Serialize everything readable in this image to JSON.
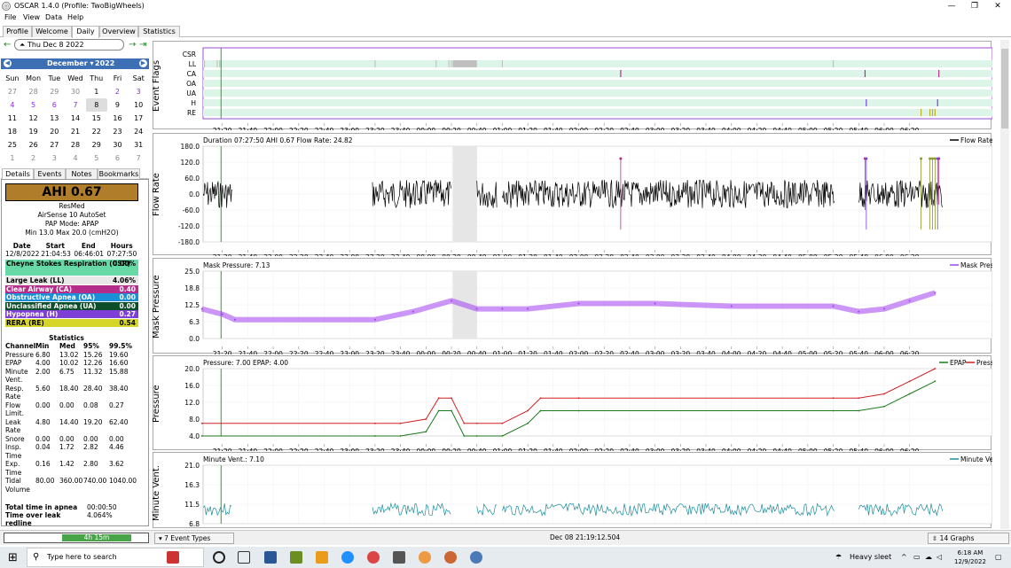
{
  "window": {
    "title": "OSCAR 1.4.0 (Profile: TwoBigWheels)",
    "icon": "oscar-icon"
  },
  "menu": [
    "File",
    "View",
    "Data",
    "Help"
  ],
  "tabs": [
    "Profile",
    "Welcome",
    "Daily",
    "Overview",
    "Statistics"
  ],
  "active_tab": "Daily",
  "date": {
    "current": "Thu Dec 8 2022"
  },
  "calendar": {
    "month": "December",
    "year": "2022",
    "dow": [
      "Sun",
      "Mon",
      "Tue",
      "Wed",
      "Thu",
      "Fri",
      "Sat"
    ],
    "weeks": [
      [
        "27",
        "28",
        "29",
        "30",
        "1",
        "2",
        "3"
      ],
      [
        "4",
        "5",
        "6",
        "7",
        "8",
        "9",
        "10"
      ],
      [
        "11",
        "12",
        "13",
        "14",
        "15",
        "16",
        "17"
      ],
      [
        "18",
        "19",
        "20",
        "21",
        "22",
        "23",
        "24"
      ],
      [
        "25",
        "26",
        "27",
        "28",
        "29",
        "30",
        "31"
      ],
      [
        "1",
        "2",
        "3",
        "4",
        "5",
        "6",
        "7"
      ]
    ]
  },
  "side_tabs": [
    "Details",
    "Events",
    "Notes",
    "Bookmarks"
  ],
  "details": {
    "ahi": "AHI 0.67",
    "brand": "ResMed",
    "model": "AirSense 10 AutoSet",
    "mode": "PAP Mode: APAP",
    "pressure": "Min 13.0 Max 20.0 (cmH2O)",
    "session_headers": [
      "Date",
      "Start",
      "End",
      "Hours"
    ],
    "session": [
      "12/8/2022",
      "21:04:53",
      "06:46:01",
      "07:27:50"
    ],
    "indices": [
      {
        "label": "Cheyne Stokes Respiration (CSR)",
        "value": "0.00%",
        "color": "#66d9a6"
      },
      {
        "label": "Large Leak (LL)",
        "value": "4.06%",
        "color": "#e8e8e8"
      },
      {
        "label": "Clear Airway (CA)",
        "value": "0.40",
        "color": "#b52d8a"
      },
      {
        "label": "Obstructive Apnea (OA)",
        "value": "0.00",
        "color": "#1a8ed6"
      },
      {
        "label": "Unclassified Apnea (UA)",
        "value": "0.00",
        "color": "#0e4d2a"
      },
      {
        "label": "Hypopnea (H)",
        "value": "0.27",
        "color": "#7e3fd6"
      },
      {
        "label": "RERA (RE)",
        "value": "0.54",
        "color": "#d6d62a"
      }
    ],
    "stats_title": "Statistics",
    "stats_headers": [
      "Channel",
      "Min",
      "Med",
      "95%",
      "99.5%"
    ],
    "stats_rows": [
      [
        "Pressure",
        "6.80",
        "13.02",
        "15.26",
        "19.60"
      ],
      [
        "EPAP",
        "4.00",
        "10.02",
        "12.26",
        "16.60"
      ],
      [
        "Minute Vent.",
        "2.00",
        "6.75",
        "11.32",
        "15.88"
      ],
      [
        "Resp. Rate",
        "5.60",
        "18.40",
        "28.40",
        "38.40"
      ],
      [
        "Flow Limit.",
        "0.00",
        "0.00",
        "0.08",
        "0.27"
      ],
      [
        "Leak Rate",
        "4.80",
        "14.40",
        "19.20",
        "62.40"
      ],
      [
        "Snore",
        "0.00",
        "0.00",
        "0.00",
        "0.00"
      ],
      [
        "Insp. Time",
        "0.04",
        "1.72",
        "2.82",
        "4.46"
      ],
      [
        "Exp. Time",
        "0.16",
        "1.42",
        "2.80",
        "3.62"
      ],
      [
        "Tidal Volume",
        "80.00",
        "360.00",
        "740.00",
        "1040.00"
      ]
    ],
    "totals": [
      [
        "Total time in apnea",
        "00:00:50"
      ],
      [
        "Time over leak redline",
        "4.064%"
      ]
    ]
  },
  "bottom": {
    "duration_bar": "4h 15m",
    "event_types": "7 Event Types",
    "cursor_time": "Dec 08 21:19:12.504",
    "graphs": "14 Graphs"
  },
  "time_ticks": [
    "21:20",
    "21:40",
    "22:00",
    "22:20",
    "22:40",
    "23:00",
    "23:20",
    "23:40",
    "00:00",
    "00:20",
    "00:40",
    "01:00",
    "01:20",
    "01:40",
    "02:00",
    "02:20",
    "02:40",
    "03:00",
    "03:20",
    "03:40",
    "04:00",
    "04:20",
    "04:40",
    "05:00",
    "05:20",
    "05:40",
    "06:00",
    "06:20"
  ],
  "time_range": [
    "21:04:53",
    "06:46:01"
  ],
  "event_flags": {
    "title": "Event Flags",
    "rows": [
      "CSR",
      "LL",
      "CA",
      "OA",
      "UA",
      "H",
      "RE"
    ]
  },
  "charts": [
    {
      "id": "flow",
      "ylabel": "Flow Rate",
      "header": "Duration 07:27:50 AHI 0.67 Flow Rate: 24.82",
      "legend": "Flow Rate",
      "color": "#000000",
      "yticks": [
        "180.0",
        "120.0",
        "60.0",
        "0.0",
        "-60.0",
        "-120.0",
        "-180.0"
      ]
    },
    {
      "id": "mask",
      "ylabel": "Mask Pressure",
      "header": "Mask Pressure: 7.13",
      "legend": "Mask Pressure",
      "color": "#a040f0",
      "yticks": [
        "25.0",
        "18.8",
        "12.5",
        "6.3",
        "0.0"
      ]
    },
    {
      "id": "pressure",
      "ylabel": "Pressure",
      "header": "Pressure: 7.00 EPAP: 4.00",
      "legend_a": "EPAP",
      "legend_b": "Pressure",
      "color_a": "#1a7a1a",
      "color_b": "#d02020",
      "yticks": [
        "20.0",
        "16.0",
        "12.0",
        "8.0",
        "4.0"
      ]
    },
    {
      "id": "minvent",
      "ylabel": "Minute Vent.",
      "header": "Minute Vent.: 7.10",
      "legend": "Minute Vent.",
      "color": "#1a8c9c",
      "yticks": [
        "21.0",
        "16.3",
        "11.5",
        "6.8"
      ]
    }
  ],
  "chart_data": [
    {
      "type": "line",
      "title": "Mask Pressure",
      "x": [
        "21:04",
        "21:20",
        "21:30",
        "23:20",
        "23:50",
        "00:20",
        "00:40",
        "01:00",
        "01:20",
        "02:00",
        "03:00",
        "04:00",
        "05:20",
        "05:40",
        "06:00",
        "06:20",
        "06:40"
      ],
      "y": [
        11,
        9,
        7,
        7,
        10,
        14,
        11,
        11,
        11,
        13,
        13,
        12,
        12,
        10,
        11,
        14,
        17
      ]
    },
    {
      "type": "line",
      "title": "Pressure",
      "series": [
        {
          "name": "EPAP",
          "x": [
            "21:04",
            "23:20",
            "23:40",
            "00:00",
            "00:10",
            "00:20",
            "00:30",
            "00:40",
            "01:00",
            "01:20",
            "01:30",
            "02:00",
            "05:20",
            "05:40",
            "06:00",
            "06:20",
            "06:40"
          ],
          "y": [
            4,
            4,
            4,
            5,
            10,
            10,
            4,
            4,
            4,
            7,
            10,
            10,
            10,
            10,
            11,
            14,
            17
          ]
        },
        {
          "name": "Pressure",
          "x": [
            "21:04",
            "23:20",
            "23:40",
            "00:00",
            "00:10",
            "00:20",
            "00:30",
            "00:40",
            "01:00",
            "01:20",
            "01:30",
            "02:00",
            "05:20",
            "05:40",
            "06:00",
            "06:20",
            "06:40"
          ],
          "y": [
            7,
            7,
            7,
            8,
            13,
            13,
            7,
            7,
            7,
            10,
            13,
            13,
            13,
            13,
            14,
            17,
            20
          ]
        }
      ],
      "ylim": [
        4,
        20
      ]
    }
  ],
  "taskbar": {
    "search": "Type here to search",
    "weather": "Heavy sleet",
    "time": "6:18 AM",
    "date": "12/9/2022"
  }
}
